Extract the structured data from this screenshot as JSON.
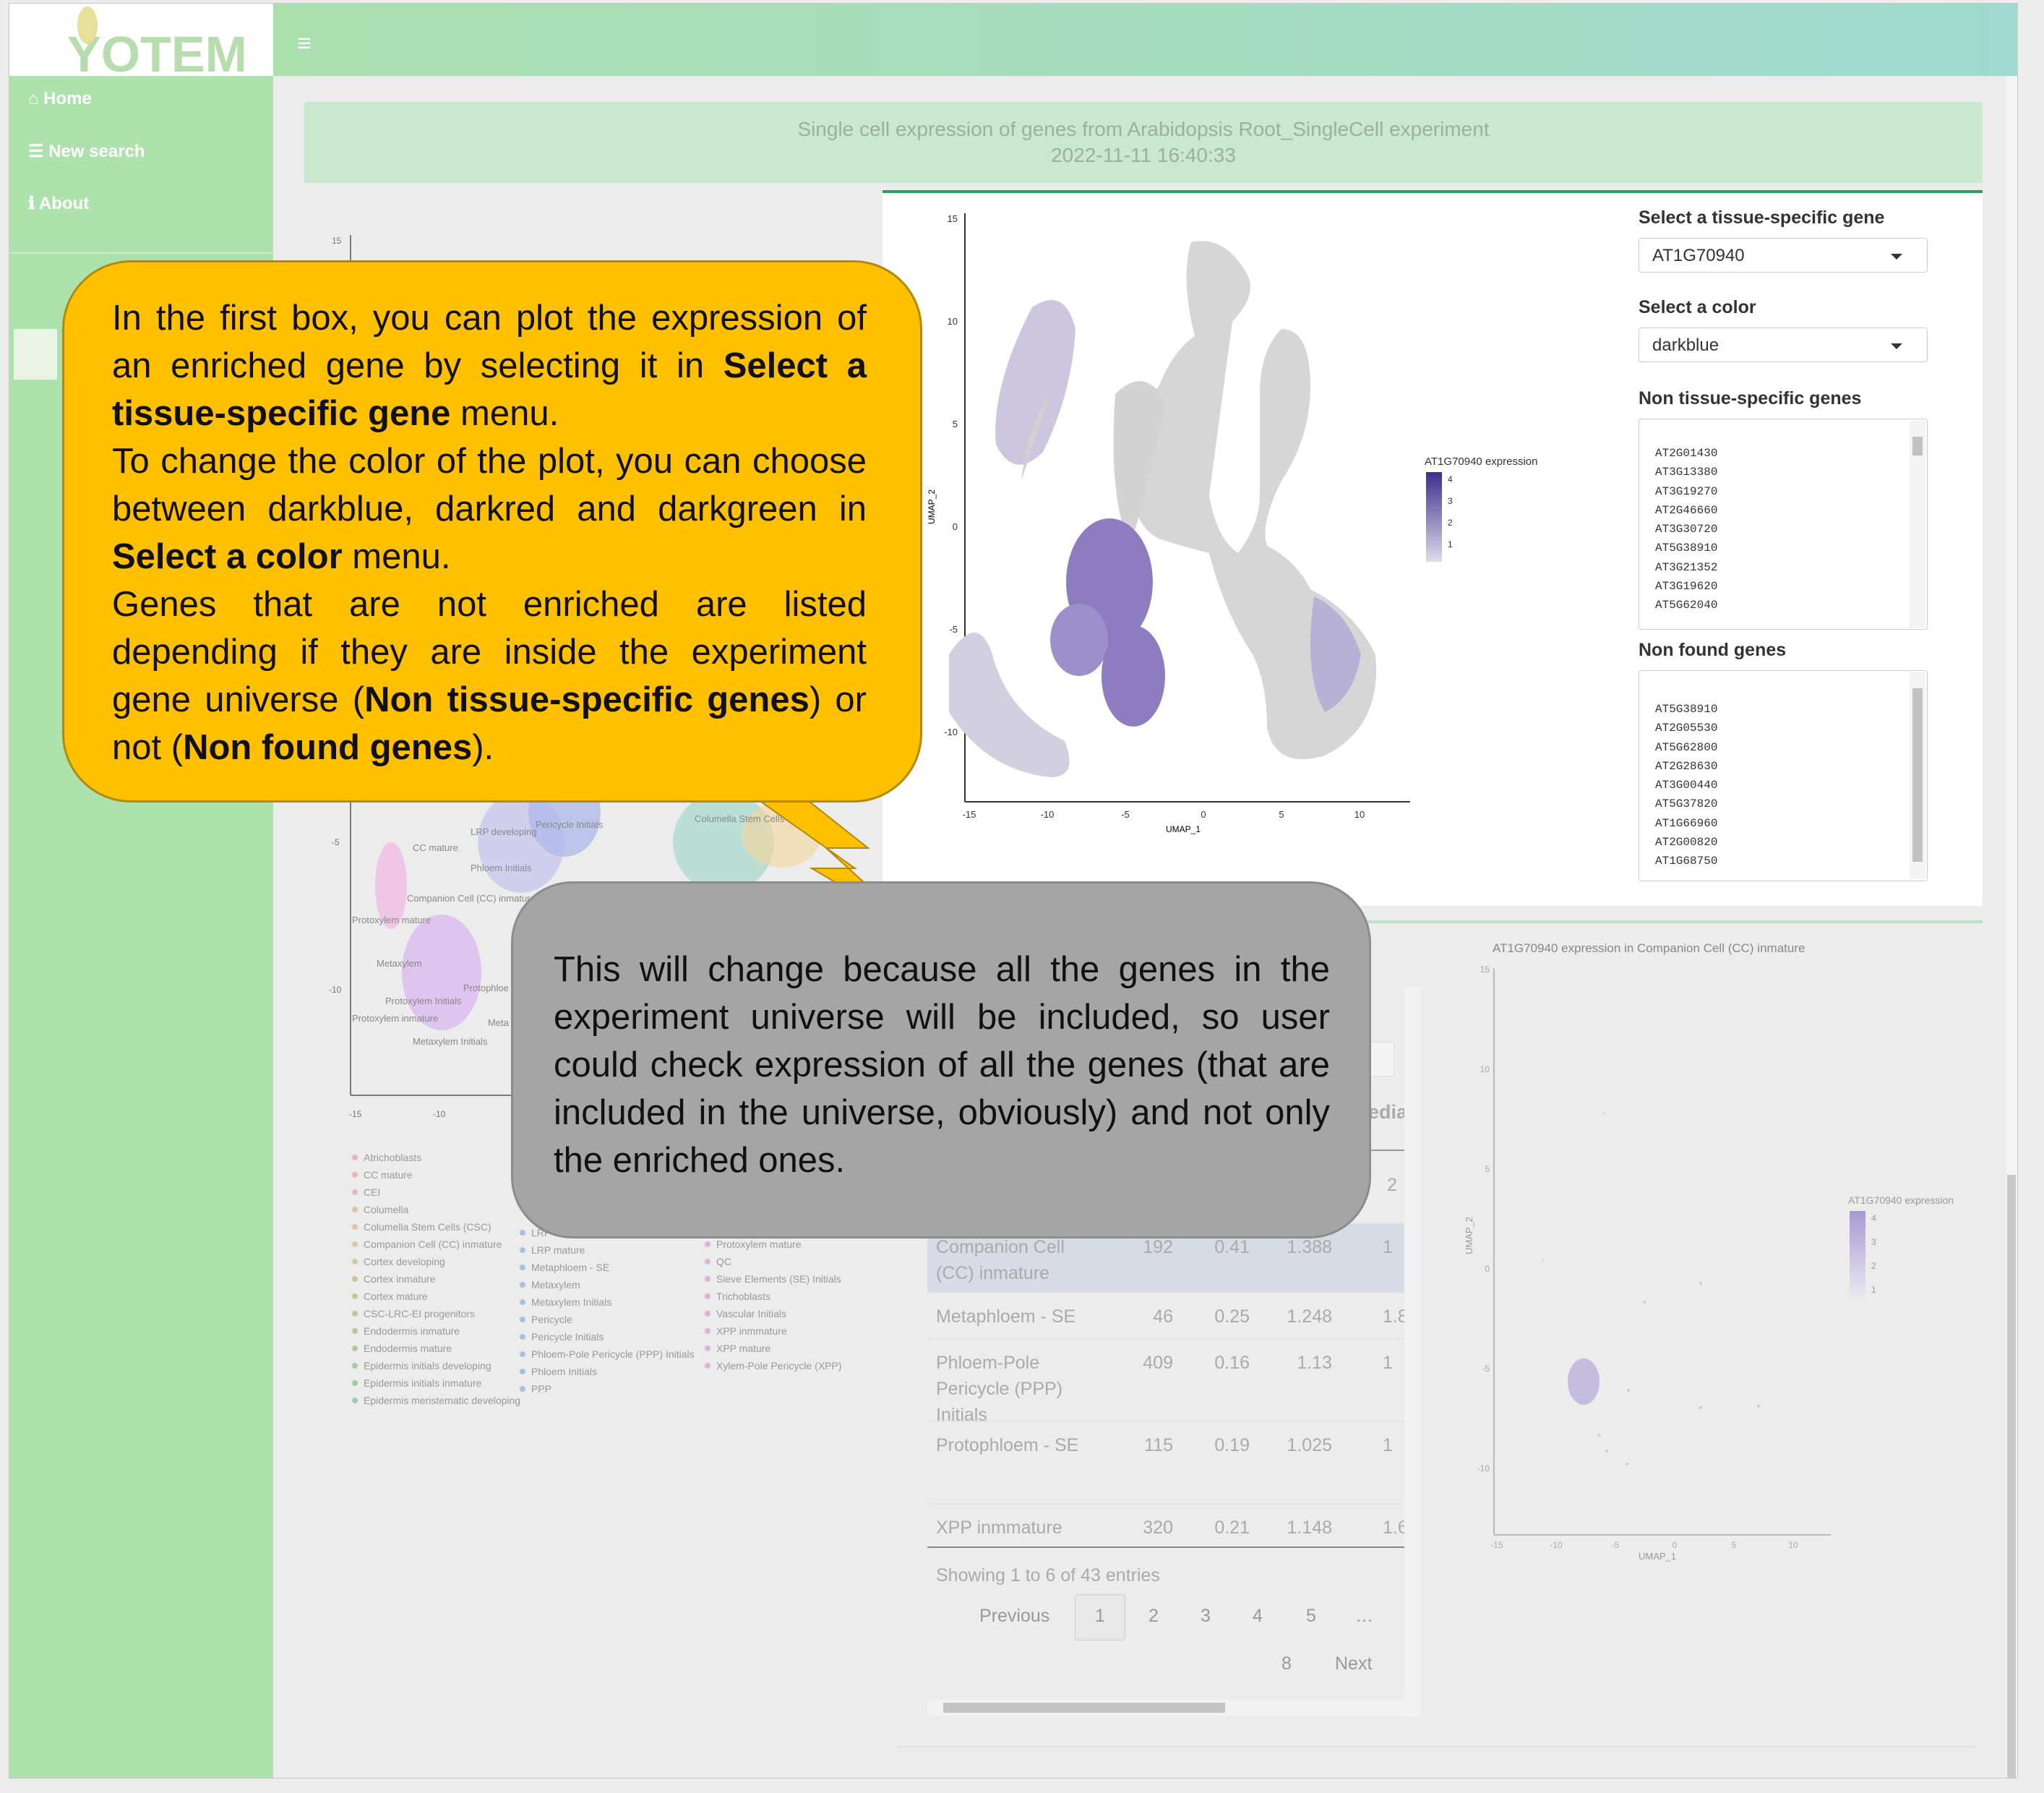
{
  "app": {
    "logo": "YOTEM"
  },
  "sidebar": {
    "items": [
      {
        "icon": "home-icon",
        "label": "Home"
      },
      {
        "icon": "database-icon",
        "label": "New search"
      },
      {
        "icon": "info-icon",
        "label": "About"
      }
    ]
  },
  "banner": {
    "title": "Single cell expression of genes from Arabidopsis Root_SingleCell experiment",
    "timestamp": "2022-11-11 16:40:33"
  },
  "main_plot": {
    "legend_title": "AT1G70940 expression",
    "legend_ticks": [
      "4",
      "3",
      "2",
      "1"
    ],
    "xlabel": "UMAP_1",
    "ylabel": "UMAP_2",
    "x_ticks": [
      "-15",
      "-10",
      "-5",
      "0",
      "5",
      "10"
    ],
    "y_ticks": [
      "15",
      "10",
      "5",
      "0",
      "-5",
      "-10"
    ]
  },
  "controls": {
    "gene_label": "Select a tissue-specific gene",
    "gene_value": "AT1G70940",
    "color_label": "Select a color",
    "color_value": "darkblue",
    "non_specific_label": "Non tissue-specific genes",
    "non_specific_genes": [
      "AT2G01430",
      "AT3G13380",
      "AT3G19270",
      "AT2G46660",
      "AT3G30720",
      "AT5G38910",
      "AT3G21352",
      "AT3G19620",
      "AT5G62040"
    ],
    "non_found_label": "Non found genes",
    "non_found_genes": [
      "AT5G38910",
      "AT2G05530",
      "AT5G62800",
      "AT2G28630",
      "AT3G00440",
      "AT5G37820",
      "AT1G66960",
      "AT2G00820",
      "AT1G68750"
    ]
  },
  "cluster_plot": {
    "labels": [
      "Pericycle Initials",
      "Columella Stem Cells",
      "CC mature",
      "LRP developing",
      "Phloem Initials",
      "Companion Cell (CC) inmature",
      "Protoxylem mature",
      "Metaxylem",
      "Protoxylem Initials",
      "Protophloe",
      "Protoxylem inmature",
      "Meta",
      "Metaxylem Initials"
    ],
    "x_ticks": [
      "-15",
      "-10"
    ],
    "y_ticks": [
      "15",
      "-5",
      "-10"
    ],
    "legend_col1": [
      "Atrichoblasts",
      "CC mature",
      "CEI",
      "Columella",
      "Columella Stem Cells (CSC)",
      "Companion Cell (CC) inmature",
      "Cortex developing",
      "Cortex inmature",
      "Cortex mature",
      "CSC-LRC-EI progenitors",
      "Endodermis inmature",
      "Endodermis mature",
      "Epidermis initials developing",
      "Epidermis initials inmature",
      "Epidermis meristematic developing"
    ],
    "legend_col2": [
      "LRP developing",
      "LRP mature",
      "Metaphloem - SE",
      "Metaxylem",
      "Metaxylem Initials",
      "Pericycle",
      "Pericycle Initials",
      "Phloem-Pole Pericycle (PPP) Initials",
      "Phloem Initials",
      "PPP"
    ],
    "legend_col3": [
      "Protoxylem mature",
      "QC",
      "Sieve Elements (SE) Initials",
      "Trichoblasts",
      "Vascular Initials",
      "XPP inmmature",
      "XPP mature",
      "Xylem-Pole Pericycle (XPP)"
    ]
  },
  "table": {
    "header_partial": "edia",
    "rows": [
      {
        "name": "Companion Cell (CC) inmature",
        "n": "192",
        "a": "0.41",
        "b": "1.388",
        "c": "1"
      },
      {
        "name": "Metaphloem - SE",
        "n": "46",
        "a": "0.25",
        "b": "1.248",
        "c": "1.8"
      },
      {
        "name": "Phloem-Pole Pericycle (PPP) Initials",
        "n": "409",
        "a": "0.16",
        "b": "1.13",
        "c": "1"
      },
      {
        "name": "Protophloem - SE",
        "n": "115",
        "a": "0.19",
        "b": "1.025",
        "c": "1"
      },
      {
        "name": "XPP inmmature",
        "n": "320",
        "a": "0.21",
        "b": "1.148",
        "c": "1.6"
      }
    ],
    "partial_value": "2",
    "info": "Showing 1 to 6 of 43 entries",
    "pagination": {
      "previous": "Previous",
      "pages": [
        "1",
        "2",
        "3",
        "4",
        "5",
        "…",
        "8"
      ],
      "next": "Next"
    }
  },
  "small_plot": {
    "title": "AT1G70940 expression in Companion Cell (CC) inmature",
    "legend_title": "AT1G70940 expression",
    "legend_ticks": [
      "4",
      "3",
      "2",
      "1"
    ],
    "xlabel": "UMAP_1",
    "ylabel": "UMAP_2",
    "x_ticks": [
      "-15",
      "-10",
      "-5",
      "0",
      "5",
      "10"
    ],
    "y_ticks": [
      "15",
      "10",
      "5",
      "0",
      "-5",
      "-10"
    ]
  },
  "callouts": {
    "yellow": [
      {
        "text": "In the first box, you can plot the expression of an enriched gene by selecting it in ",
        "bold": false
      },
      {
        "text": "Select a tissue-specific gene",
        "bold": true
      },
      {
        "text": " menu.",
        "bold": false
      },
      {
        "text": "To change the color of the plot, you can choose between darkblue, darkred and darkgreen in ",
        "bold": false,
        "newline": true
      },
      {
        "text": "Select a color",
        "bold": true
      },
      {
        "text": " menu.",
        "bold": false
      },
      {
        "text": "Genes that are not enriched are listed depending if they are inside the experiment gene universe (",
        "bold": false,
        "newline": true
      },
      {
        "text": "Non tissue-specific genes",
        "bold": true
      },
      {
        "text": ") or not (",
        "bold": false
      },
      {
        "text": "Non found genes",
        "bold": true
      },
      {
        "text": ").",
        "bold": false
      }
    ],
    "gray": "This will change because all the genes in the experiment universe will be included, so user could check expression of all the genes (that are included in the universe, obviously) and not only the enriched ones."
  }
}
